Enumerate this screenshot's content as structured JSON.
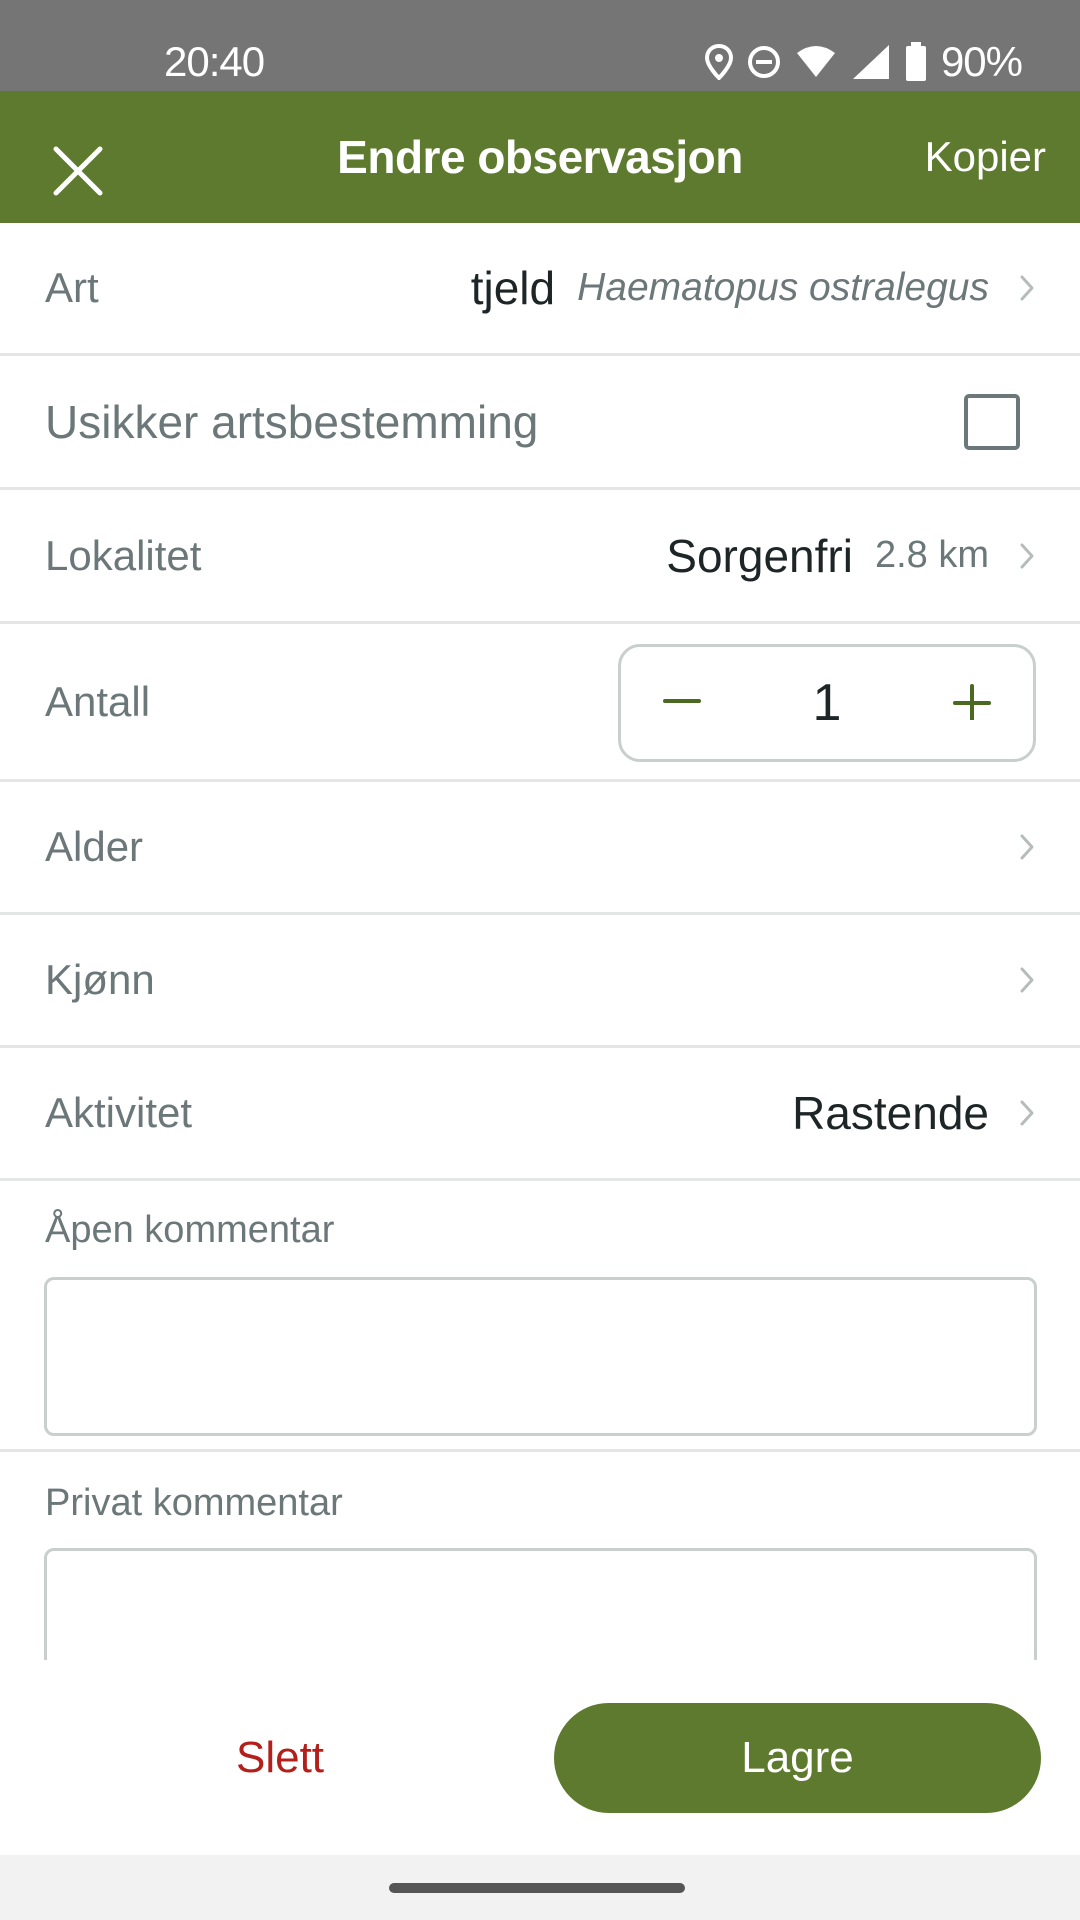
{
  "status_bar": {
    "time": "20:40",
    "battery": "90%",
    "icons": [
      "location-icon",
      "do-not-disturb-icon",
      "wifi-icon",
      "signal-icon",
      "battery-icon"
    ]
  },
  "app_bar": {
    "title": "Endre observasjon",
    "copy_label": "Kopier",
    "background": "#5d7a2e"
  },
  "form": {
    "species": {
      "label": "Art",
      "common_name": "tjeld",
      "scientific_name": "Haematopus ostralegus"
    },
    "uncertain": {
      "label": "Usikker artsbestemming",
      "checked": false
    },
    "locality": {
      "label": "Lokalitet",
      "value": "Sorgenfri",
      "distance": "2.8 km"
    },
    "count": {
      "label": "Antall",
      "value": "1",
      "minus": "−",
      "plus": "+"
    },
    "age": {
      "label": "Alder"
    },
    "sex": {
      "label": "Kjønn"
    },
    "activity": {
      "label": "Aktivitet",
      "value": "Rastende"
    },
    "open_comment": {
      "label": "Åpen kommentar",
      "value": ""
    },
    "private_comment": {
      "label": "Privat kommentar",
      "value": ""
    }
  },
  "actions": {
    "delete_label": "Slett",
    "save_label": "Lagre",
    "delete_color": "#b3201c"
  }
}
